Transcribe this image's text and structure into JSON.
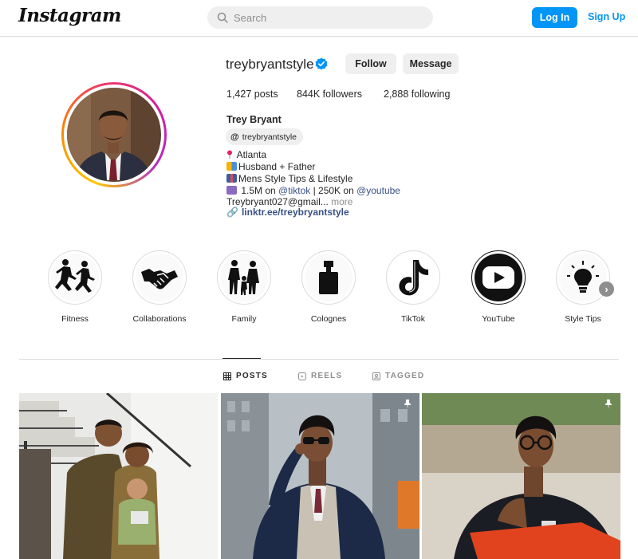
{
  "app": {
    "logo_text": "Instagram"
  },
  "search": {
    "placeholder": "Search"
  },
  "auth": {
    "login_label": "Log In",
    "signup_label": "Sign Up"
  },
  "profile": {
    "username": "treybryantstyle",
    "follow_label": "Follow",
    "message_label": "Message",
    "stats": {
      "posts": "1,427 posts",
      "followers": "844K followers",
      "following": "2,888 following"
    },
    "full_name": "Trey Bryant",
    "threads_handle": "treybryantstyle",
    "bio": {
      "line1": "Atlanta",
      "line2": "Husband + Father",
      "line3": "Mens Style Tips & Lifestyle",
      "line4_a": "1.5M on ",
      "line4_tiktok": "@tiktok",
      "line4_b": " | 250K on ",
      "line4_youtube": "@youtube",
      "line5": "Treybryant027@gmail...",
      "more": "more"
    },
    "link": "linktr.ee/treybryantstyle"
  },
  "highlights": [
    {
      "label": "Fitness",
      "icon": "runners-icon"
    },
    {
      "label": "Collaborations",
      "icon": "handshake-icon"
    },
    {
      "label": "Family",
      "icon": "family-icon"
    },
    {
      "label": "Colognes",
      "icon": "cologne-bottle-icon"
    },
    {
      "label": "TikTok",
      "icon": "tiktok-icon"
    },
    {
      "label": "YouTube",
      "icon": "youtube-icon"
    },
    {
      "label": "Style Tips",
      "icon": "lightbulb-icon"
    }
  ],
  "tabs": [
    {
      "label": "POSTS",
      "icon": "grid-icon",
      "active": true
    },
    {
      "label": "REELS",
      "icon": "reels-icon",
      "active": false
    },
    {
      "label": "TAGGED",
      "icon": "tagged-icon",
      "active": false
    }
  ],
  "posts": [
    {
      "subject": "family-photo-stairs",
      "pinned": false
    },
    {
      "subject": "suit-sunglasses-street",
      "pinned": true
    },
    {
      "subject": "glasses-outdoor-portrait",
      "pinned": true
    }
  ],
  "colors": {
    "accent": "#0095f6",
    "link": "#385185",
    "text": "#262626",
    "muted": "#8e8e8e",
    "border": "#dbdbdb"
  }
}
